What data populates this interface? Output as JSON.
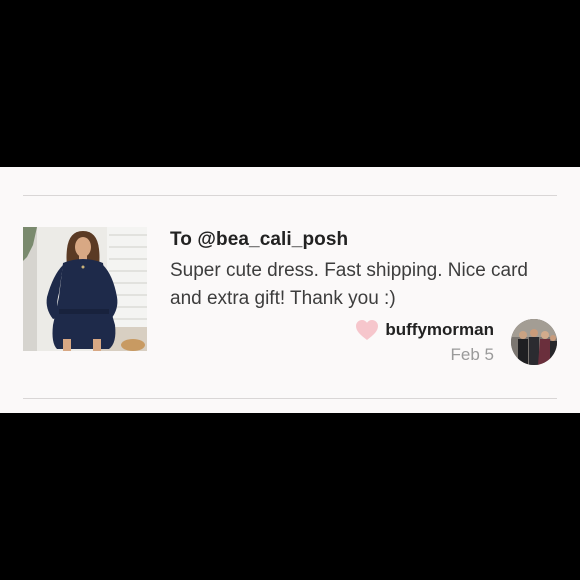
{
  "review": {
    "recipient": "To @bea_cali_posh",
    "comment": "Super cute dress. Fast shipping. Nice card and extra gift! Thank you :)",
    "author": "buffymorman",
    "date": "Feb 5"
  },
  "colors": {
    "heart": "#f6c6cc",
    "card_background": "#fbf9f9",
    "divider": "#d9d6d6"
  },
  "icons": {
    "heart": "heart-icon"
  }
}
